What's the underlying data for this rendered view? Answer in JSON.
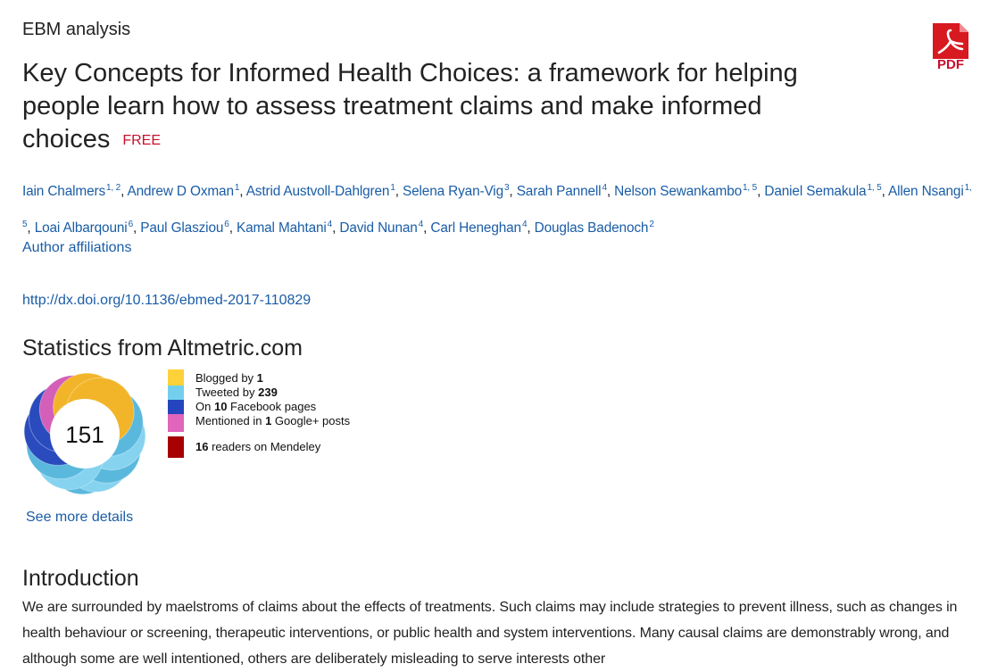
{
  "article": {
    "section": "EBM analysis",
    "title": "Key Concepts for Informed Health Choices: a framework for helping people learn how to assess treatment claims and make informed choices",
    "free_badge": "FREE",
    "pdf_label": "PDF",
    "authors": [
      {
        "name": "Iain Chalmers",
        "sup": "1, 2"
      },
      {
        "name": "Andrew D Oxman",
        "sup": "1"
      },
      {
        "name": "Astrid Austvoll-Dahlgren",
        "sup": "1"
      },
      {
        "name": "Selena Ryan-Vig",
        "sup": "3"
      },
      {
        "name": "Sarah Pannell",
        "sup": "4"
      },
      {
        "name": "Nelson Sewankambo",
        "sup": "1, 5"
      },
      {
        "name": "Daniel Semakula",
        "sup": "1, 5"
      },
      {
        "name": "Allen Nsangi",
        "sup": "1, 5"
      },
      {
        "name": "Loai Albarqouni",
        "sup": "6"
      },
      {
        "name": "Paul Glasziou",
        "sup": "6"
      },
      {
        "name": "Kamal Mahtani",
        "sup": "4"
      },
      {
        "name": "David Nunan",
        "sup": "4"
      },
      {
        "name": "Carl Heneghan",
        "sup": "4"
      },
      {
        "name": "Douglas Badenoch",
        "sup": "2"
      }
    ],
    "affiliations_link": "Author affiliations",
    "doi": "http://dx.doi.org/10.1136/ebmed-2017-110829"
  },
  "altmetric": {
    "heading": "Statistics from Altmetric.com",
    "score": "151",
    "legend": [
      {
        "prefix": "Blogged by ",
        "count": "1",
        "suffix": "",
        "color": "#fdd13a"
      },
      {
        "prefix": "Tweeted by ",
        "count": "239",
        "suffix": "",
        "color": "#74cfed"
      },
      {
        "prefix": "On ",
        "count": "10",
        "suffix": " Facebook pages",
        "color": "#2445bd"
      },
      {
        "prefix": "Mentioned in ",
        "count": "1",
        "suffix": " Google+ posts",
        "color": "#e065bb"
      },
      {
        "prefix": "",
        "count": "16",
        "suffix": " readers on Mendeley",
        "color": "#a60000"
      }
    ],
    "see_more": "See more details",
    "donut_colors": {
      "twitter": "#5bb8dd",
      "twitter_light": "#86d3f0",
      "facebook": "#2a4bbd",
      "google": "#d45fb8",
      "blog": "#f2b52a"
    }
  },
  "introduction": {
    "heading": "Introduction",
    "body": "We are surrounded by maelstroms of claims about the effects of treatments. Such claims may include strategies to prevent illness, such as changes in health behaviour or screening, therapeutic interventions, or public health and system interventions. Many causal claims are demonstrably wrong, and although some are well intentioned, others are deliberately misleading to serve interests other"
  }
}
